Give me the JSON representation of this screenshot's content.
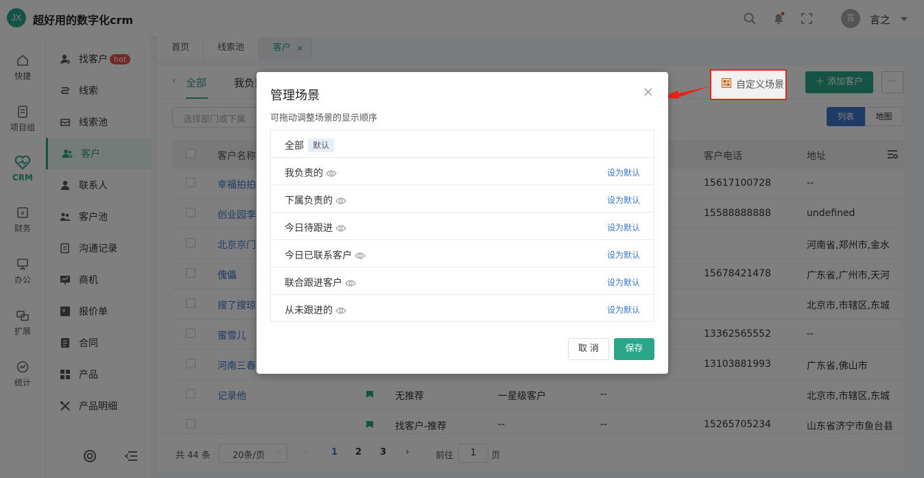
{
  "app": {
    "logo_text": "JX",
    "title": "超好用的数字化crm",
    "user_initial": "言",
    "user_name": "言之"
  },
  "rail": [
    {
      "label": "快捷",
      "icon": "home-icon"
    },
    {
      "label": "项目组",
      "icon": "document-icon"
    },
    {
      "label": "CRM",
      "icon": "heart-icon",
      "active": true
    },
    {
      "label": "财务",
      "icon": "wallet-icon"
    },
    {
      "label": "办公",
      "icon": "monitor-icon"
    },
    {
      "label": "扩展",
      "icon": "extension-icon"
    },
    {
      "label": "统计",
      "icon": "chart-icon"
    }
  ],
  "submenu": [
    {
      "label": "找客户",
      "badge": "hot"
    },
    {
      "label": "线索"
    },
    {
      "label": "线索池"
    },
    {
      "label": "客户",
      "active": true
    },
    {
      "label": "联系人"
    },
    {
      "label": "客户池"
    },
    {
      "label": "沟通记录"
    },
    {
      "label": "商机"
    },
    {
      "label": "报价单"
    },
    {
      "label": "合同"
    },
    {
      "label": "产品"
    },
    {
      "label": "产品明细"
    }
  ],
  "tabs": [
    {
      "label": "首页"
    },
    {
      "label": "线索池"
    },
    {
      "label": "客户",
      "active": true
    }
  ],
  "page": {
    "scene_all": "全部",
    "scene_mine": "我负责",
    "custom_scene": "自定义场景",
    "add_customer": "添加客户",
    "dept_placeholder": "选择部门或下属",
    "view_list": "列表",
    "view_map": "地图"
  },
  "table": {
    "headers": {
      "name": "客户名称",
      "phone": "客户电话",
      "address": "地址"
    },
    "rows": [
      {
        "name": "幸福拍拍",
        "source": "",
        "level": "",
        "c4": "",
        "phone": "15617100728",
        "address": "--"
      },
      {
        "name": "创业园李",
        "source": "",
        "level": "",
        "c4": "",
        "phone": "15588888888",
        "address": "undefined"
      },
      {
        "name": "北京京门",
        "source": "",
        "level": "",
        "c4": "",
        "phone": "",
        "address": "河南省,郑州市,金水"
      },
      {
        "name": "傀儡",
        "source": "",
        "level": "",
        "c4": "",
        "phone": "15678421478",
        "address": "广东省,广州市,天河"
      },
      {
        "name": "搜了搜琼",
        "source": "",
        "level": "",
        "c4": "",
        "phone": "",
        "address": "北京市,市辖区,东城"
      },
      {
        "name": "蜜雪儿",
        "source": "",
        "level": "",
        "c4": "",
        "phone": "13362565552",
        "address": "--"
      },
      {
        "name": "河南三春",
        "source": "",
        "level": "",
        "c4": "",
        "phone": "13103881993",
        "address": "广东省,佛山市"
      },
      {
        "name": "记录他",
        "source": "无推荐",
        "level": "一星级客户",
        "c4": "--",
        "phone": "",
        "address": "北京市,市辖区,东城"
      },
      {
        "name": "",
        "source": "找客户-推荐",
        "level": "--",
        "c4": "--",
        "phone": "15265705234",
        "address": "山东省济宁市鱼台县"
      }
    ]
  },
  "pagination": {
    "total": "共 44 条",
    "page_size": "20条/页",
    "pages": [
      "1",
      "2",
      "3"
    ],
    "goto_label": "前往",
    "goto_value": "1",
    "page_suffix": "页"
  },
  "dialog": {
    "title": "管理场景",
    "hint": "可拖动调整场景的显示顺序",
    "default_badge": "默认",
    "set_default": "设为默认",
    "scenes": [
      "全部",
      "我负责的",
      "下属负责的",
      "今日待跟进",
      "今日已联系客户",
      "联合跟进客户",
      "从未跟进的"
    ],
    "cancel": "取 消",
    "save": "保存"
  },
  "colors": {
    "brand": "#2aa788",
    "link": "#3a77c8",
    "annotation": "#e8231a"
  }
}
